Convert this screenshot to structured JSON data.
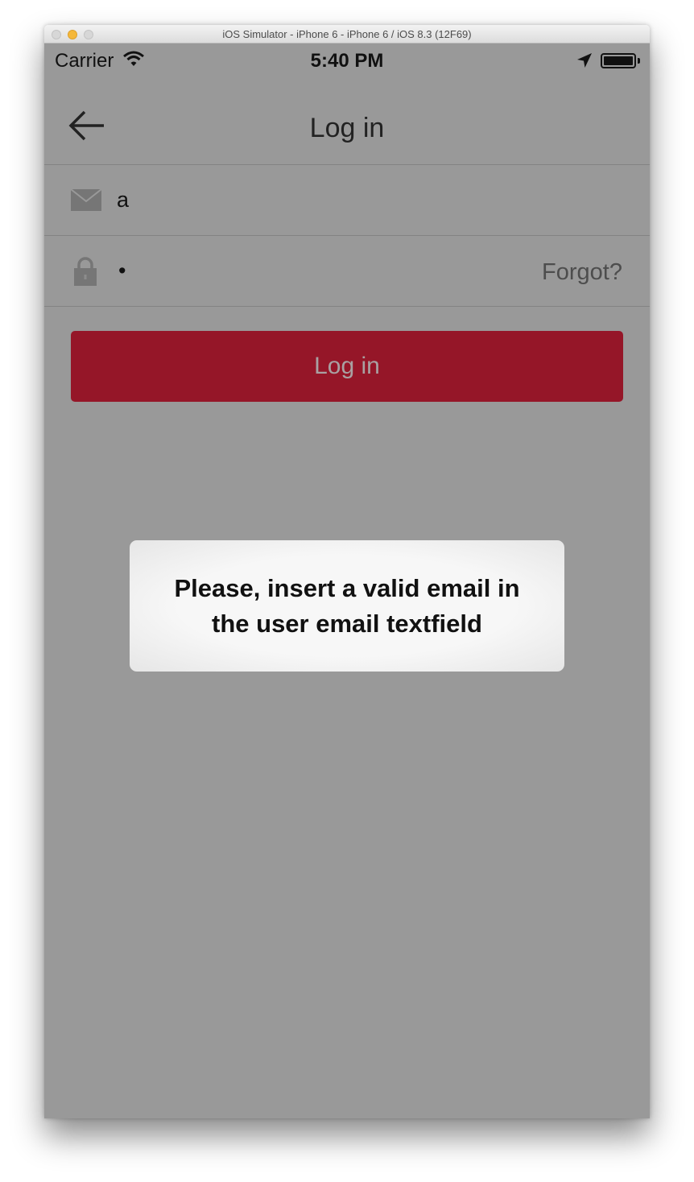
{
  "window": {
    "title": "iOS Simulator - iPhone 6 - iPhone 6 / iOS 8.3 (12F69)"
  },
  "status_bar": {
    "carrier": "Carrier",
    "time": "5:40 PM",
    "icons": [
      "wifi-icon",
      "location-arrow-icon",
      "battery-icon"
    ]
  },
  "nav_bar": {
    "title": "Log in",
    "back_icon": "back-arrow-icon"
  },
  "form": {
    "email_icon": "envelope-icon",
    "email_value": "a",
    "password_icon": "lock-icon",
    "password_value": "•",
    "forgot_label": "Forgot?"
  },
  "login_button": {
    "label": "Log in"
  },
  "toast": {
    "message": "Please, insert a valid email in the user email textfield"
  },
  "colors": {
    "overlay_background": "#999999",
    "login_button": "#951628",
    "toast_background": "#f4f4f4"
  }
}
